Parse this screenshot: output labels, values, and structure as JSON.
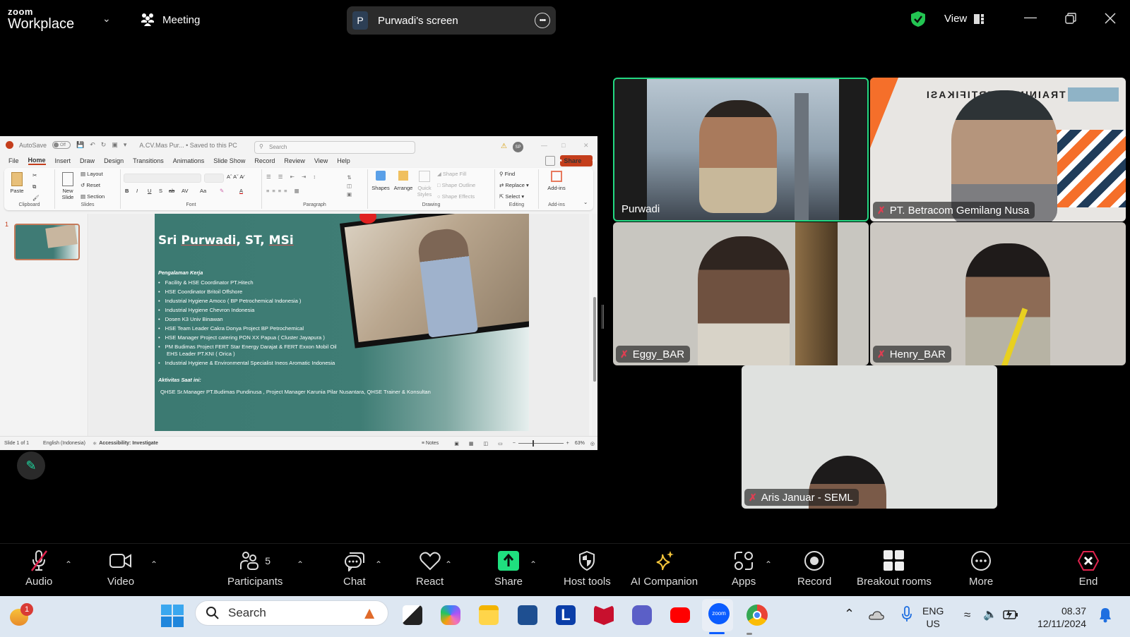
{
  "app": {
    "brand_top": "zoom",
    "brand_bottom": "Workplace",
    "meeting_label": "Meeting"
  },
  "share_pill": {
    "initial": "P",
    "title": "Purwadi's screen"
  },
  "header_right": {
    "view_label": "View"
  },
  "powerpoint": {
    "autosave_label": "AutoSave",
    "autosave_state": "Off",
    "file_title": "A.CV.Mas Pur... • Saved to this PC",
    "search_placeholder": "Search",
    "user_initials": "SP",
    "tabs": [
      "File",
      "Home",
      "Insert",
      "Draw",
      "Design",
      "Transitions",
      "Animations",
      "Slide Show",
      "Record",
      "Review",
      "View",
      "Help"
    ],
    "active_tab": "Home",
    "share_label": "Share",
    "ribbon": {
      "clipboard": {
        "paste": "Paste",
        "group": "Clipboard"
      },
      "slides": {
        "new_slide": "New Slide",
        "layout": "Layout",
        "reset": "Reset",
        "section": "Section",
        "group": "Slides"
      },
      "font": {
        "group": "Font",
        "buttons": [
          "B",
          "I",
          "U",
          "S",
          "ab",
          "AV",
          "Aa"
        ]
      },
      "paragraph": {
        "group": "Paragraph"
      },
      "drawing": {
        "shapes": "Shapes",
        "arrange": "Arrange",
        "quick_styles": "Quick Styles",
        "shape_fill": "Shape Fill",
        "shape_outline": "Shape Outline",
        "shape_effects": "Shape Effects",
        "group": "Drawing"
      },
      "editing": {
        "find": "Find",
        "replace": "Replace",
        "select": "Select",
        "group": "Editing"
      },
      "addins": {
        "label": "Add-ins",
        "group": "Add-ins"
      }
    },
    "thumbnail_number": "1",
    "slide": {
      "title_plain": "Sri ",
      "title_u1": "Purwadi",
      "title_mid": ", ST, ",
      "title_u2": "MSi",
      "section1": "Pengalaman Kerja",
      "experience": [
        "Facility & HSE Coordinator PT.Hitech",
        "HSE Coordinator Britoil Offshore",
        "Industrial Hygiene Amoco ( BP Petrochemical Indonesia )",
        "Industrial Hygiene  Chevron Indonesia",
        "Dosen K3 Univ Binawan",
        "HSE Team Leader Cakra Donya Project  BP Petrochemical",
        "HSE Manager Project catering PON XX Papua ( Cluster Jayapura )",
        "PM Budimas Project FERT  Star Energy Darajat & FERT Exxon Mobil Oil",
        "Industrial Hygiene & Environmental Specialist Ineos Aromatic Indonesia"
      ],
      "experience_continuation": "EHS Leader PT.KNI  ( Orica )",
      "section2": "Aktivitas Saat ini:",
      "activity": "QHSE Sr.Manager PT.Budimas Pundinusa , Project Manager  Karunia Pilar Nusantara, QHSE Trainer & Konsultan"
    },
    "status": {
      "slide_count": "Slide 1 of 1",
      "language": "English (Indonesia)",
      "accessibility": "Accessibility: Investigate",
      "notes": "Notes",
      "zoom": "63%"
    }
  },
  "participants_tiles": [
    {
      "name": "Purwadi",
      "muted": false,
      "active_speaker": true
    },
    {
      "name": "PT. Betracom Gemilang Nusa",
      "muted": true,
      "banner": "TRAINING SERTIFIKASI"
    },
    {
      "name": "Eggy_BAR",
      "muted": true
    },
    {
      "name": "Henry_BAR",
      "muted": true
    },
    {
      "name": "Aris Januar - SEML",
      "muted": true
    }
  ],
  "toolbar": {
    "audio": "Audio",
    "video": "Video",
    "participants": "Participants",
    "participants_count": "5",
    "chat": "Chat",
    "react": "React",
    "share": "Share",
    "host_tools": "Host tools",
    "ai_companion": "AI Companion",
    "apps": "Apps",
    "record": "Record",
    "breakout_rooms": "Breakout rooms",
    "more": "More",
    "end": "End"
  },
  "colors": {
    "accent_green": "#23d982",
    "share_green": "#1fe07f",
    "end_red": "#e0234e",
    "ppt_orange": "#c43e1c",
    "slide_teal": "#3f7d75"
  },
  "taskbar": {
    "notification_badge": "1",
    "search_placeholder": "Search",
    "language_top": "ENG",
    "language_bottom": "US",
    "time": "08.37",
    "date": "12/11/2024",
    "zoom_app_label": "zoom"
  }
}
